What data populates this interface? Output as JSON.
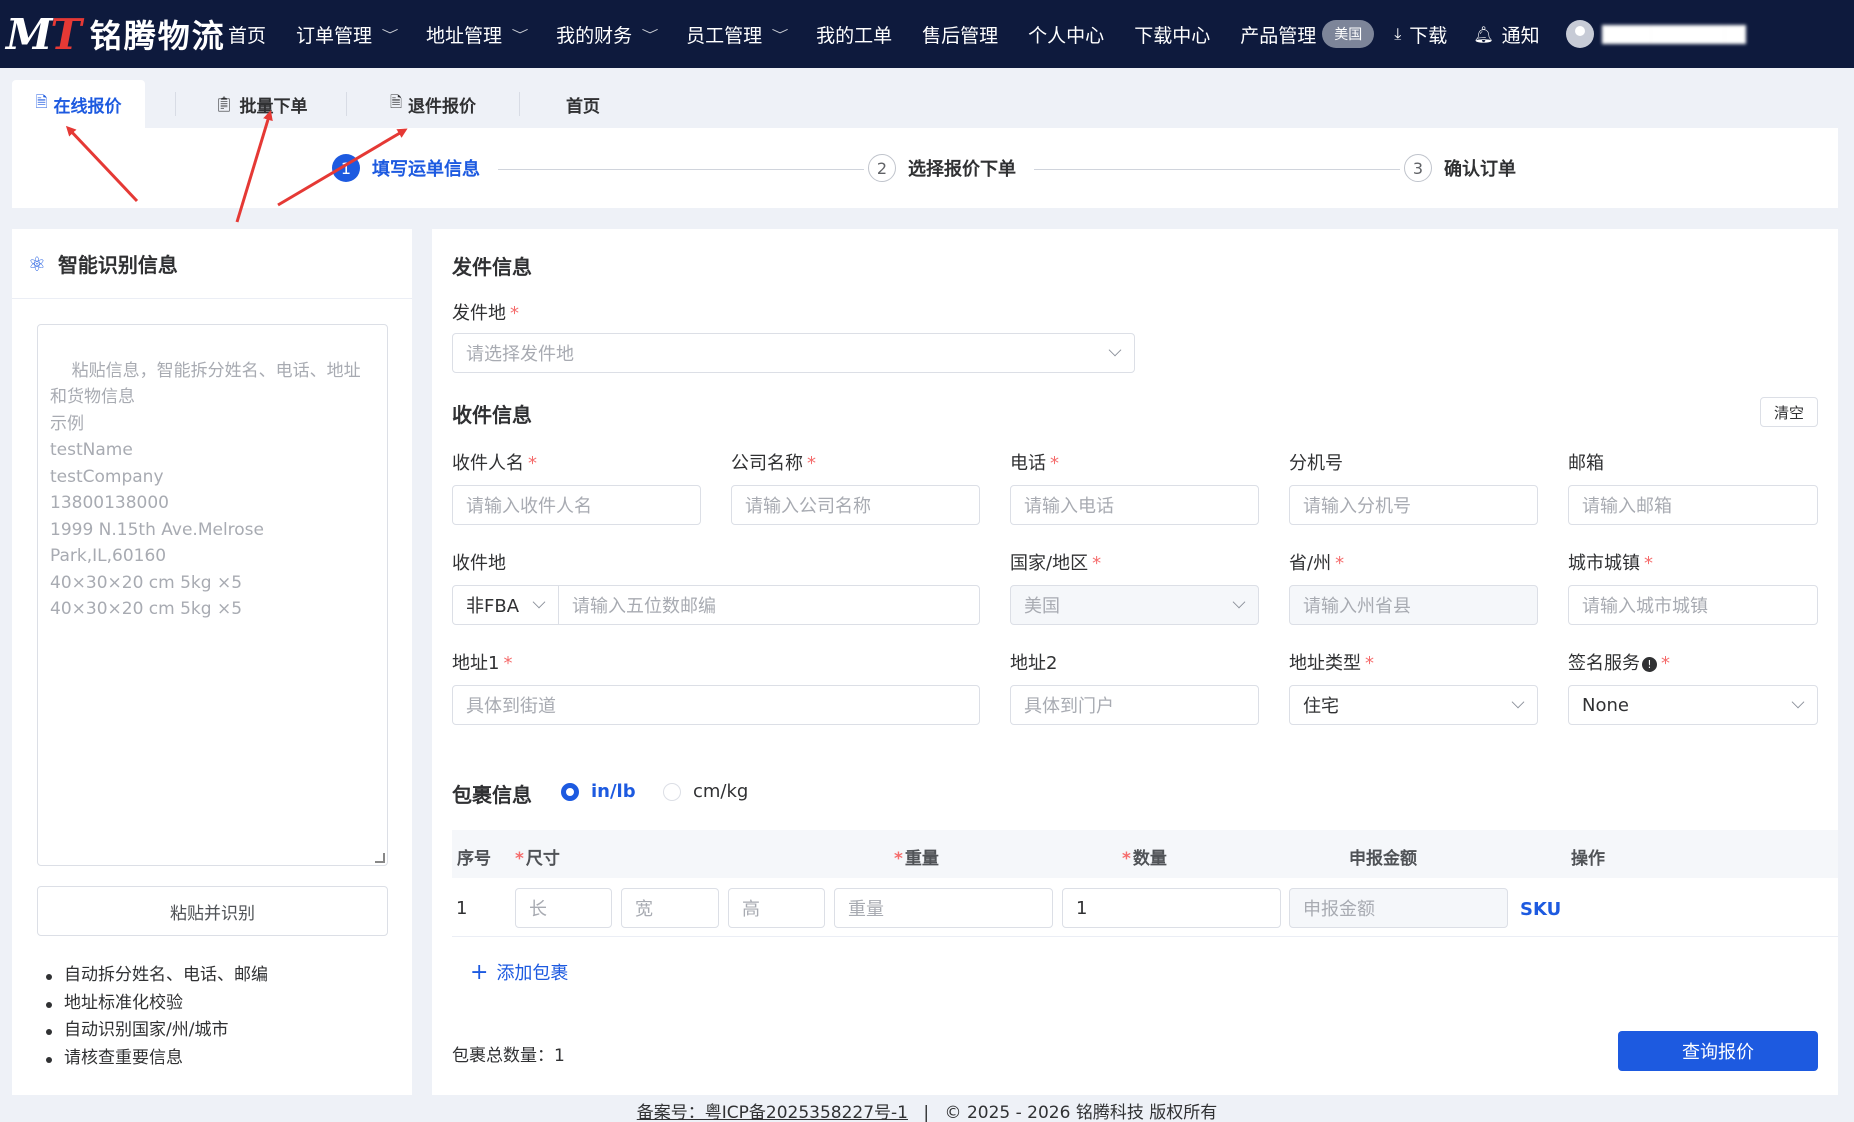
{
  "brand": {
    "logo_mark": "MT",
    "logo_text": "铭腾物流"
  },
  "nav": {
    "items": [
      {
        "label": "首页",
        "dropdown": false
      },
      {
        "label": "订单管理",
        "dropdown": true
      },
      {
        "label": "地址管理",
        "dropdown": true
      },
      {
        "label": "我的财务",
        "dropdown": true
      },
      {
        "label": "员工管理",
        "dropdown": true
      },
      {
        "label": "我的工单",
        "dropdown": false
      },
      {
        "label": "售后管理",
        "dropdown": false
      },
      {
        "label": "个人中心",
        "dropdown": false
      },
      {
        "label": "下载中心",
        "dropdown": false
      },
      {
        "label": "产品管理",
        "dropdown": false
      }
    ],
    "region_badge": "美国",
    "download": "下载",
    "notify": "通知"
  },
  "tabs": [
    {
      "label": "在线报价",
      "active": true
    },
    {
      "label": "批量下单",
      "active": false
    },
    {
      "label": "退件报价",
      "active": false
    },
    {
      "label": "首页",
      "active": false
    }
  ],
  "steps": [
    {
      "num": "1",
      "label": "填写运单信息",
      "active": true
    },
    {
      "num": "2",
      "label": "选择报价下单",
      "active": false
    },
    {
      "num": "3",
      "label": "确认订单",
      "active": false
    }
  ],
  "smart": {
    "title": "智能识别信息",
    "placeholder": "粘贴信息，智能拆分姓名、电话、地址和货物信息\n示例\ntestName\ntestCompany\n13800138000\n1999 N.15th Ave.Melrose Park,IL,60160\n40×30×20 cm 5kg ×5\n40×30×20 cm 5kg ×5",
    "paste_button": "粘贴并识别",
    "tips": [
      "自动拆分姓名、电话、邮编",
      "地址标准化校验",
      "自动识别国家/州/城市",
      "请核查重要信息"
    ]
  },
  "sender": {
    "title": "发件信息",
    "origin_label": "发件地",
    "origin_placeholder": "请选择发件地"
  },
  "recipient": {
    "title": "收件信息",
    "clear_button": "清空",
    "name_label": "收件人名",
    "name_placeholder": "请输入收件人名",
    "company_label": "公司名称",
    "company_placeholder": "请输入公司名称",
    "phone_label": "电话",
    "phone_placeholder": "请输入电话",
    "ext_label": "分机号",
    "ext_placeholder": "请输入分机号",
    "email_label": "邮箱",
    "email_placeholder": "请输入邮箱",
    "dest_label": "收件地",
    "dest_type": "非FBA",
    "zip_placeholder": "请输入五位数邮编",
    "country_label": "国家/地区",
    "country_value": "美国",
    "state_label": "省/州",
    "state_placeholder": "请输入州省县",
    "city_label": "城市城镇",
    "city_placeholder": "请输入城市城镇",
    "addr1_label": "地址1",
    "addr1_placeholder": "具体到街道",
    "addr2_label": "地址2",
    "addr2_placeholder": "具体到门户",
    "addr_type_label": "地址类型",
    "addr_type_value": "住宅",
    "sign_label": "签名服务",
    "sign_value": "None"
  },
  "package": {
    "title": "包裹信息",
    "units": [
      {
        "label": "in/lb",
        "selected": true
      },
      {
        "label": "cm/kg",
        "selected": false
      }
    ],
    "columns": [
      "序号",
      "尺寸",
      "重量",
      "数量",
      "申报金额",
      "操作"
    ],
    "rows": [
      {
        "index": "1",
        "length_ph": "长",
        "width_ph": "宽",
        "height_ph": "高",
        "weight_ph": "重量",
        "qty": "1",
        "declared_ph": "申报金额",
        "action": "SKU"
      }
    ],
    "add_button": "添加包裹",
    "total_label": "包裹总数量：",
    "total_value": "1",
    "query_button": "查询报价"
  },
  "footer": {
    "icp": "备案号：粤ICP备2025358227号-1",
    "sep": "|",
    "copyright": "© 2025 - 2026 铭腾科技 版权所有"
  },
  "colors": {
    "nav_bg": "#0e1a3d",
    "primary": "#1d5ae0",
    "required": "#f56c6c",
    "annotation_arrow": "#e53935"
  }
}
